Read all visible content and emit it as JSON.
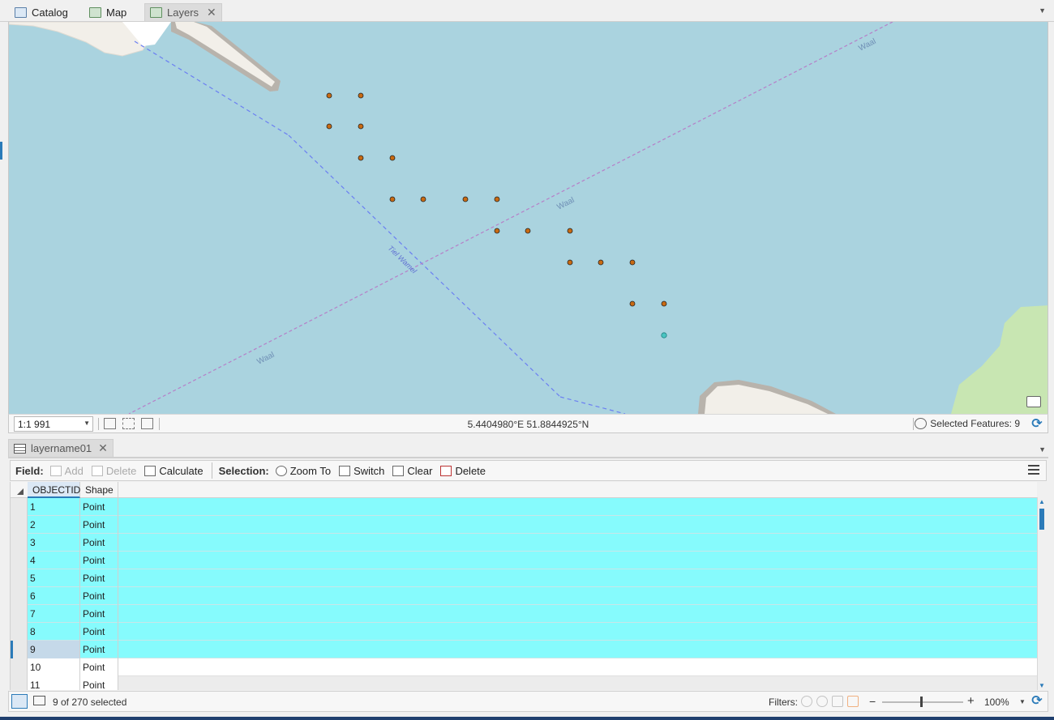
{
  "tabs": [
    {
      "label": "Catalog",
      "icon": "catalog-icon"
    },
    {
      "label": "Map",
      "icon": "map-icon"
    },
    {
      "label": "Layers",
      "icon": "layers-map-icon",
      "active": true,
      "close": "✕"
    }
  ],
  "map": {
    "labels": {
      "wool_top": "Waal",
      "wool_mid": "Waal",
      "wool_bottom": "Waal",
      "tiel": "Tiel Wamel"
    },
    "colors": {
      "water": "#aad3df",
      "land": "#f2efe9",
      "park": "#c8e6b2",
      "feature": "#c96a12",
      "selected_feature": "#49c4c1"
    }
  },
  "status": {
    "scale": "1:1 991",
    "coordinates": "5.4404980°E 51.8844925°N",
    "selected_features": "Selected Features: 9"
  },
  "table_tab": {
    "label": "layername01",
    "close": "✕"
  },
  "toolbar": {
    "field_label": "Field:",
    "add": "Add",
    "delete_field": "Delete",
    "calculate": "Calculate",
    "selection_label": "Selection:",
    "zoom_to": "Zoom To",
    "switch": "Switch",
    "clear": "Clear",
    "delete_sel": "Delete"
  },
  "table": {
    "columns": [
      "OBJECTID",
      "Shape"
    ],
    "rows": [
      {
        "id": "1",
        "shape": "Point",
        "selected": true
      },
      {
        "id": "2",
        "shape": "Point",
        "selected": true
      },
      {
        "id": "3",
        "shape": "Point",
        "selected": true
      },
      {
        "id": "4",
        "shape": "Point",
        "selected": true
      },
      {
        "id": "5",
        "shape": "Point",
        "selected": true
      },
      {
        "id": "6",
        "shape": "Point",
        "selected": true
      },
      {
        "id": "7",
        "shape": "Point",
        "selected": true
      },
      {
        "id": "8",
        "shape": "Point",
        "selected": true
      },
      {
        "id": "9",
        "shape": "Point",
        "selected": true,
        "current": true
      },
      {
        "id": "10",
        "shape": "Point",
        "selected": false
      },
      {
        "id": "11",
        "shape": "Point",
        "selected": false
      }
    ]
  },
  "bottom": {
    "selection_count": "9 of 270 selected",
    "filters_label": "Filters:",
    "zoom_minus": "−",
    "zoom_plus": "+",
    "zoom_percent": "100%"
  }
}
